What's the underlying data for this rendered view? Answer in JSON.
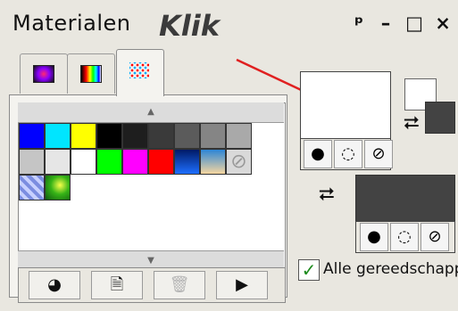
{
  "window": {
    "title": "Materialen",
    "annotation": "Klik",
    "controls": {
      "pin": "ᵖ",
      "minimize": "–",
      "maximize": "□",
      "close": "×"
    }
  },
  "tabs": [
    {
      "name": "gradient",
      "icon": "gradient-swatch-icon"
    },
    {
      "name": "rainbow",
      "icon": "rainbow-swatch-icon"
    },
    {
      "name": "swatches",
      "icon": "color-dots-icon"
    }
  ],
  "swatches": {
    "row1": [
      "#0000ff",
      "#00e5ff",
      "#ffff00",
      "#000000",
      "#1e1e1e",
      "#3a3a3a",
      "#5b5b5b",
      "#858585",
      "#a9a9a9"
    ],
    "row2": [
      "#c5c5c5",
      "#e6e6e6",
      "#ffffff",
      "#00ff00",
      "#ff00ff",
      "#ff0000",
      "blue-gradient",
      "sky-gradient",
      "none"
    ],
    "row3": [
      "pattern-blue",
      "pattern-green"
    ]
  },
  "toolbar": {
    "buttons": [
      "palette-menu",
      "new-swatch",
      "delete-swatch",
      "more"
    ]
  },
  "foreground": {
    "color": "#ffffff"
  },
  "background": {
    "color": "#434343"
  },
  "checkbox": {
    "label": "Alle gereedschapp",
    "checked": true
  }
}
